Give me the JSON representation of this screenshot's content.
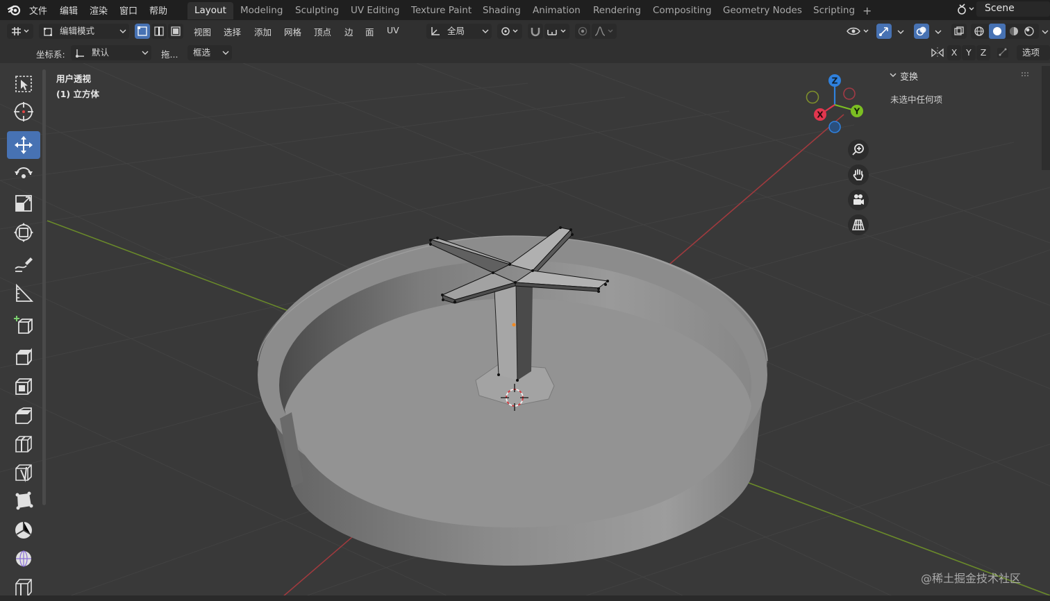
{
  "topbar": {
    "menus": [
      "文件",
      "编辑",
      "渲染",
      "窗口",
      "帮助"
    ],
    "workspaces": [
      "Layout",
      "Modeling",
      "Sculpting",
      "UV Editing",
      "Texture Paint",
      "Shading",
      "Animation",
      "Rendering",
      "Compositing",
      "Geometry Nodes",
      "Scripting"
    ],
    "active_workspace": "Layout",
    "add_tab": "+",
    "scene_name": "Scene"
  },
  "header": {
    "mode": "编辑模式",
    "menus": [
      "视图",
      "选择",
      "添加",
      "网格",
      "顶点",
      "边",
      "面",
      "UV"
    ],
    "transform_orientation": "全局",
    "coord_label": "坐标系:",
    "coord_value": "默认",
    "drag_label": "拖...",
    "select_mode": "框选",
    "axis_x": "X",
    "axis_y": "Y",
    "axis_z": "Z",
    "options_label": "选项"
  },
  "viewport": {
    "view_name": "用户透视",
    "object_name": "(1) 立方体"
  },
  "gizmo": {
    "axis_x": "X",
    "axis_y": "Y",
    "axis_z": "Z"
  },
  "npanel": {
    "section_title": "变换",
    "message": "未选中任何项"
  },
  "toolbar": {
    "tools": [
      "select-box",
      "cursor",
      "move",
      "rotate",
      "scale",
      "transform",
      "annotate",
      "measure",
      "add-cube",
      "extrude-region",
      "inset-faces",
      "bevel",
      "loop-cut",
      "knife",
      "poly-build",
      "spin",
      "smooth",
      "edge-slide"
    ],
    "active_tool": "move"
  },
  "watermark": "@稀土掘金技术社区",
  "colors": {
    "accent": "#4772b3",
    "axis_x": "#e2364e",
    "axis_y": "#7cbf22",
    "axis_z": "#2f81de",
    "viewport_bg": "#393939"
  }
}
